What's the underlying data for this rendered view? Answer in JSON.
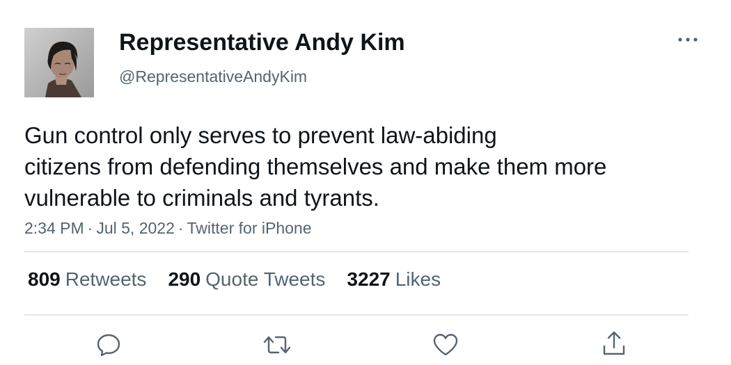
{
  "author": {
    "display_name": "Representative Andy Kim",
    "handle": "@RepresentativeAndyKim"
  },
  "tweet": {
    "text_lines": [
      "Gun control only serves to prevent law-abiding",
      "citizens from defending themselves and make them more",
      "vulnerable to criminals and tyrants."
    ],
    "time": "2:34 PM",
    "date": "Jul 5, 2022",
    "source": "Twitter for iPhone",
    "separator": "·"
  },
  "stats": {
    "retweets": {
      "count": "809",
      "label": "Retweets"
    },
    "quote_tweets": {
      "count": "290",
      "label": "Quote Tweets"
    },
    "likes": {
      "count": "3227",
      "label": "Likes"
    }
  },
  "icons": {
    "more": "more-horizontal-icon",
    "reply": "reply-icon",
    "retweet": "retweet-icon",
    "like": "heart-icon",
    "share": "share-icon"
  },
  "colors": {
    "primary_text": "#0f1419",
    "secondary_text": "#536471",
    "divider": "#e6e6e6",
    "background": "#ffffff"
  }
}
